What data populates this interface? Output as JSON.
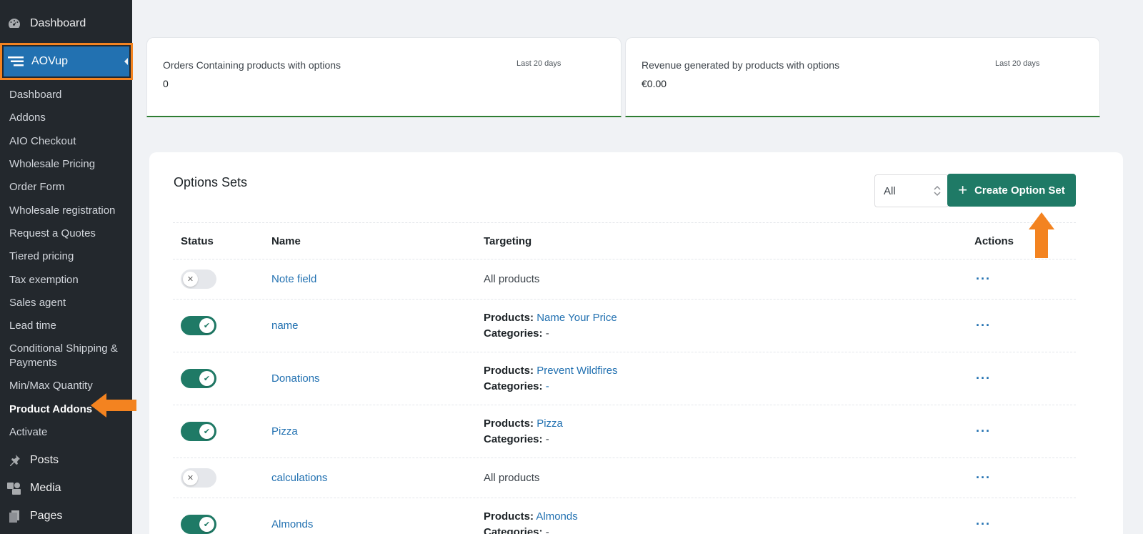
{
  "sidebar": {
    "dashboard": "Dashboard",
    "plugin": "AOVup",
    "submenu": [
      "Dashboard",
      "Addons",
      "AIO Checkout",
      "Wholesale Pricing",
      "Order Form",
      "Wholesale registration",
      "Request a Quotes",
      "Tiered pricing",
      "Tax exemption",
      "Sales agent",
      "Lead time",
      "Conditional Shipping & Payments",
      "Min/Max Quantity",
      "Product Addons",
      "Activate"
    ],
    "active_submenu": "Product Addons",
    "posts": "Posts",
    "media": "Media",
    "pages": "Pages"
  },
  "stats": [
    {
      "label": "Orders Containing products with options",
      "period": "Last 20 days",
      "value": "0"
    },
    {
      "label": "Revenue generated by products with options",
      "period": "Last 20 days",
      "value": "€0.00"
    }
  ],
  "panel": {
    "title": "Options Sets",
    "filter_value": "All",
    "create_label": "Create Option Set"
  },
  "table": {
    "headers": {
      "status": "Status",
      "name": "Name",
      "targeting": "Targeting",
      "actions": "Actions"
    },
    "labels": {
      "products": "Products:",
      "categories": "Categories:"
    },
    "rows": [
      {
        "enabled": false,
        "name": "Note field",
        "targeting": "All products"
      },
      {
        "enabled": true,
        "name": "name",
        "products": "Name Your Price",
        "categories": "-"
      },
      {
        "enabled": true,
        "name": "Donations",
        "products": "Prevent Wildfires",
        "categories": "-"
      },
      {
        "enabled": true,
        "name": "Pizza",
        "products": "Pizza",
        "categories": "-"
      },
      {
        "enabled": false,
        "name": "calculations",
        "targeting": "All products"
      },
      {
        "enabled": true,
        "name": "Almonds",
        "products": "Almonds",
        "categories": "-"
      }
    ],
    "actions_symbol": "···"
  },
  "colors": {
    "sidebar_bg": "#23282d",
    "active_menu": "#2271b1",
    "highlight": "#f38320",
    "primary": "#1f7a66",
    "link": "#2271b1"
  }
}
